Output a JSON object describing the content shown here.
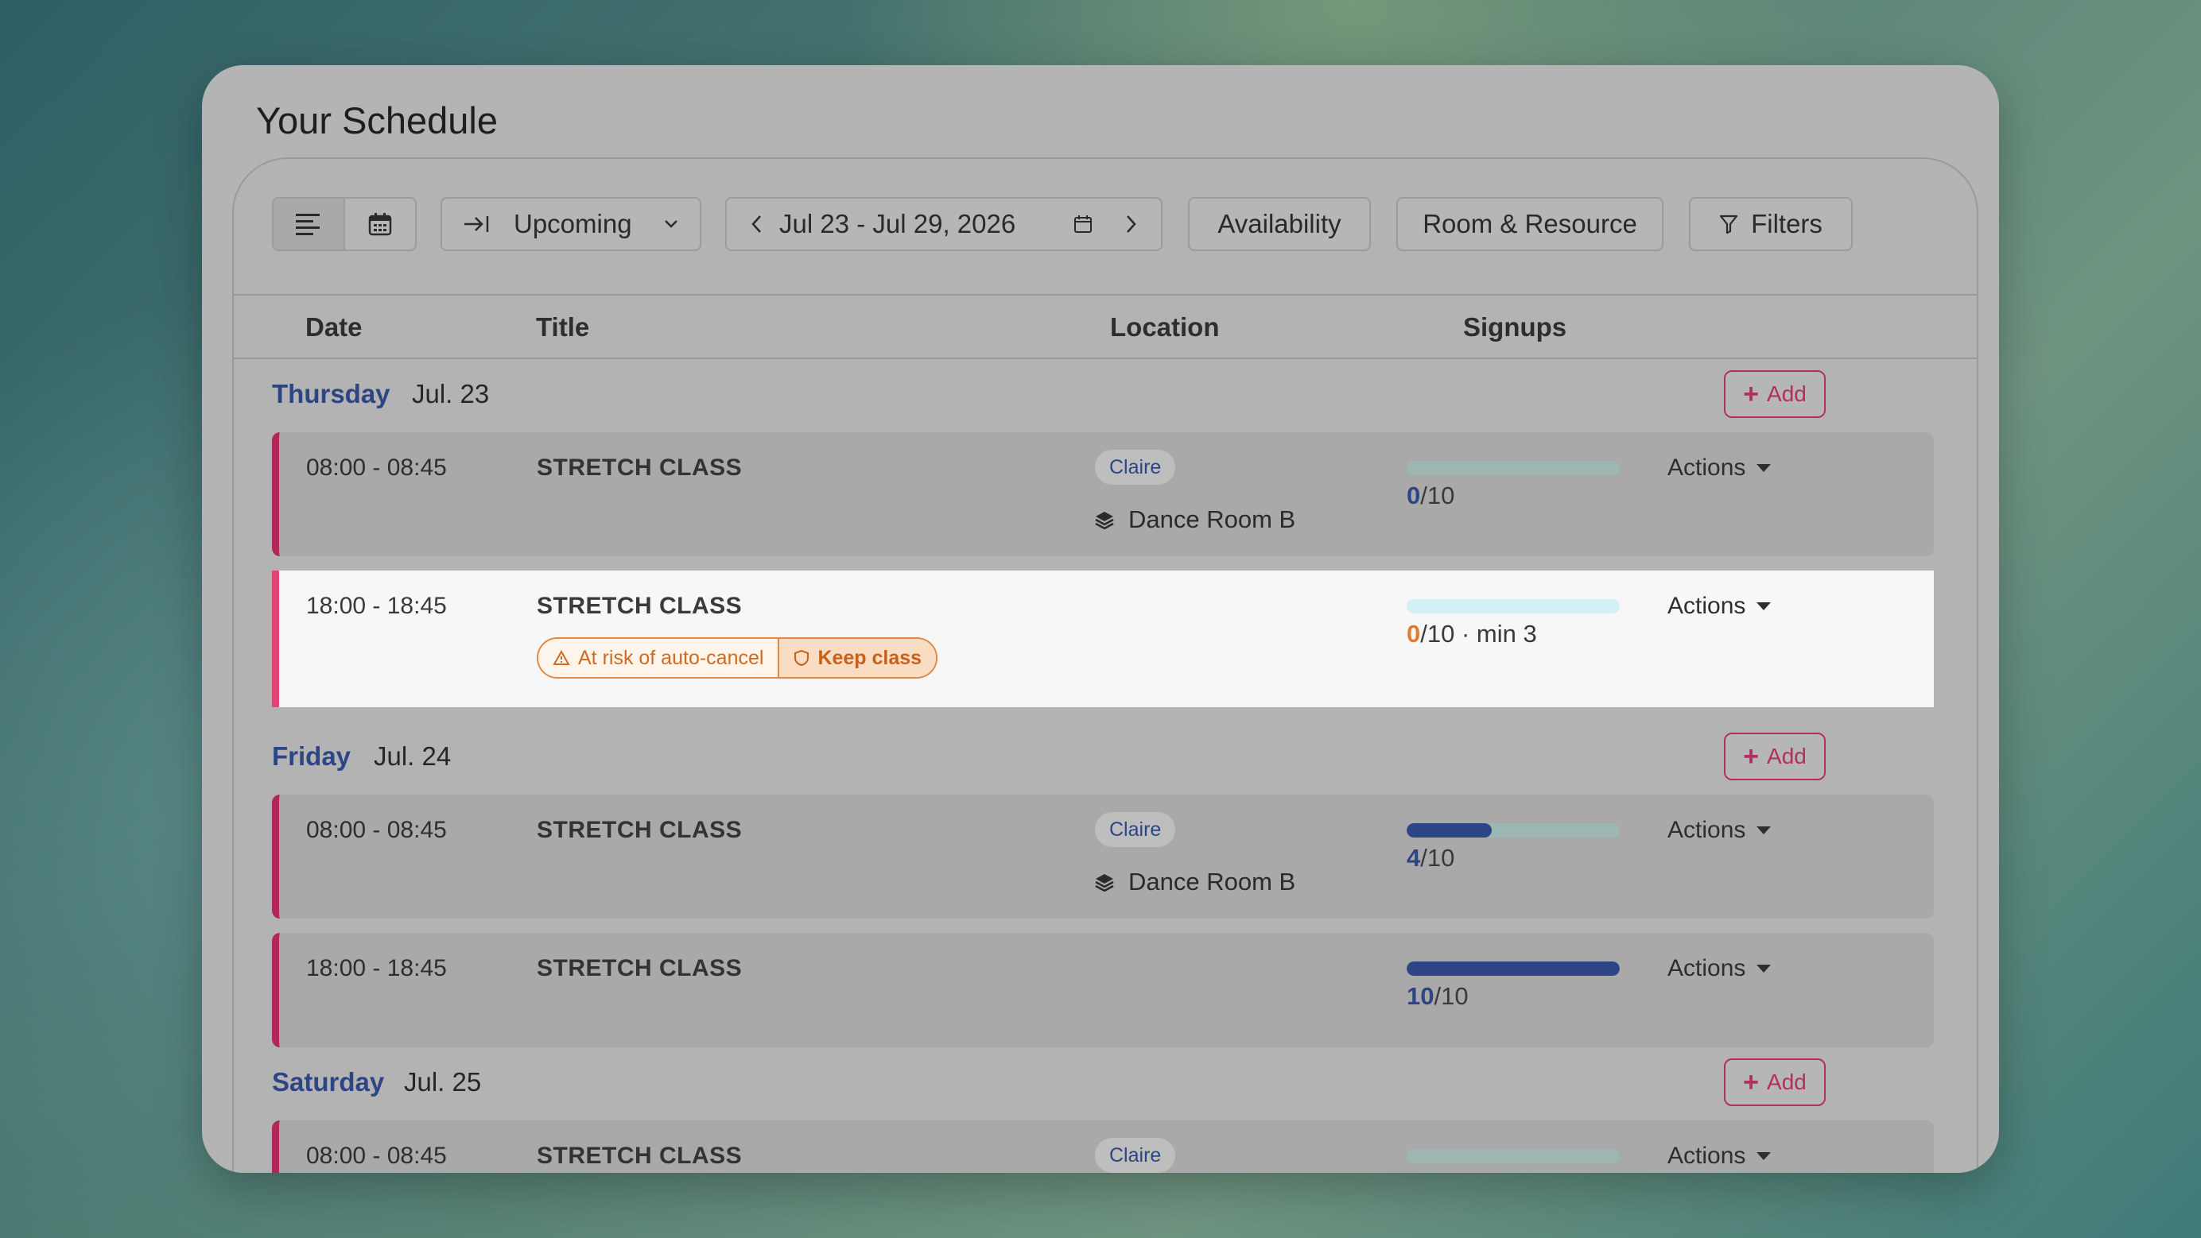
{
  "app": {
    "title": "Your Schedule"
  },
  "toolbar": {
    "view_list_icon": "list-view-icon",
    "view_calendar_icon": "calendar-view-icon",
    "range_label": "Upcoming",
    "date_range": "Jul 23 - Jul 29, 2026",
    "availability_label": "Availability",
    "room_resource_label": "Room & Resource",
    "filters_label": "Filters"
  },
  "columns": {
    "date": "Date",
    "title": "Title",
    "location": "Location",
    "signups": "Signups"
  },
  "add_label": "Add",
  "actions_label": "Actions",
  "colors": {
    "accent": "#b0285a",
    "highlight_accent": "#e04576",
    "primary": "#2d4585",
    "warning": "#e07b30"
  },
  "days": [
    {
      "day": "Thursday",
      "date": "Jul. 23",
      "classes": [
        {
          "time": "08:00 - 08:45",
          "title": "STRETCH CLASS",
          "instructor": "Claire",
          "room": "Dance Room B",
          "signups": "0",
          "capacity": "/10",
          "fill": 0
        },
        {
          "time": "18:00 - 18:45",
          "title": "STRETCH CLASS",
          "signups": "0",
          "capacity": "/10 · min 3",
          "fill": 0,
          "warning": "At risk of auto-cancel",
          "keep_label": "Keep class"
        }
      ]
    },
    {
      "day": "Friday",
      "date": "Jul. 24",
      "classes": [
        {
          "time": "08:00 - 08:45",
          "title": "STRETCH CLASS",
          "instructor": "Claire",
          "room": "Dance Room B",
          "signups": "4",
          "capacity": "/10",
          "fill": 0.4
        },
        {
          "time": "18:00 - 18:45",
          "title": "STRETCH CLASS",
          "signups": "10",
          "capacity": "/10",
          "fill": 1.0
        }
      ]
    },
    {
      "day": "Saturday",
      "date": "Jul. 25",
      "classes": [
        {
          "time": "08:00 - 08:45",
          "title": "STRETCH CLASS",
          "instructor": "Claire",
          "fill": 0
        }
      ]
    }
  ]
}
